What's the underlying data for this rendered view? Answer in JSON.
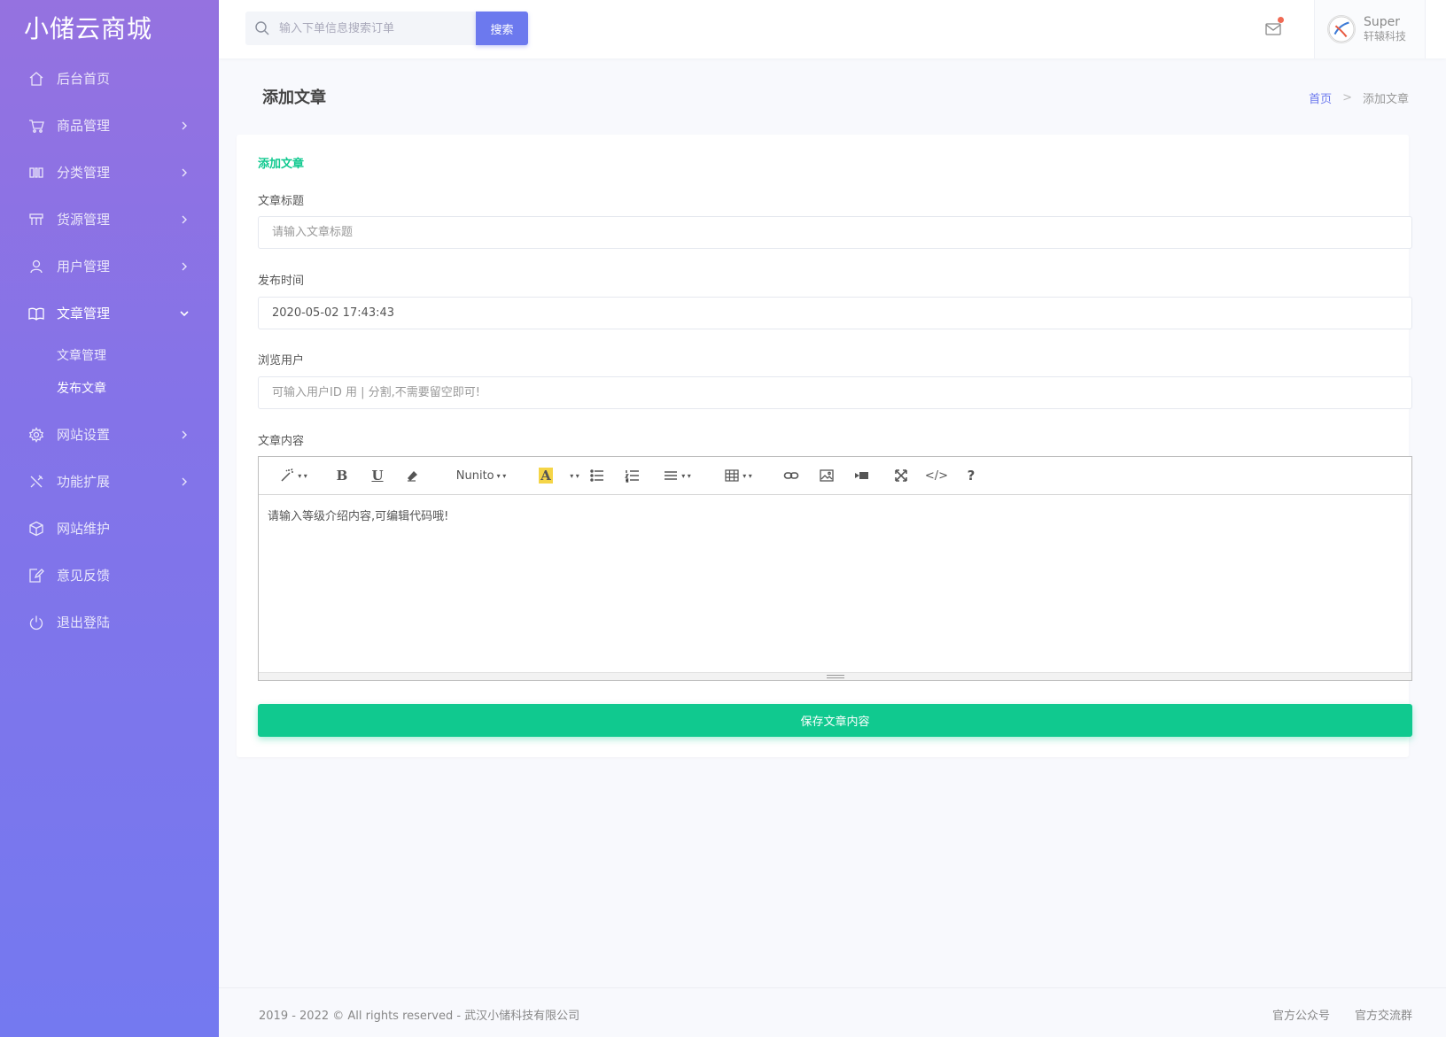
{
  "app": {
    "brand": "小储云商城"
  },
  "sidebar": {
    "items": [
      {
        "label": "后台首页"
      },
      {
        "label": "商品管理"
      },
      {
        "label": "分类管理"
      },
      {
        "label": "货源管理"
      },
      {
        "label": "用户管理"
      },
      {
        "label": "文章管理",
        "sub": [
          {
            "label": "文章管理"
          },
          {
            "label": "发布文章"
          }
        ]
      },
      {
        "label": "网站设置"
      },
      {
        "label": "功能扩展"
      },
      {
        "label": "网站维护"
      },
      {
        "label": "意见反馈"
      },
      {
        "label": "退出登陆"
      }
    ]
  },
  "topbar": {
    "search_placeholder": "输入下单信息搜索订单",
    "search_button": "搜索",
    "user_name": "Super",
    "user_company": "轩辕科技"
  },
  "page": {
    "title": "添加文章",
    "breadcrumb": {
      "home": "首页",
      "separator": ">",
      "current": "添加文章"
    }
  },
  "form": {
    "card_title": "添加文章",
    "title_label": "文章标题",
    "title_placeholder": "请输入文章标题",
    "time_label": "发布时间",
    "time_value": "2020-05-02 17:43:43",
    "users_label": "浏览用户",
    "users_placeholder": "可输入用户ID 用 | 分割,不需要留空即可!",
    "content_label": "文章内容",
    "editor_font": "Nunito",
    "editor_content": "请输入等级介绍内容,可编辑代码哦!",
    "save_button": "保存文章内容"
  },
  "footer": {
    "copyright": "2019 - 2022 © All rights reserved - 武汉小储科技有限公司",
    "links": [
      "官方公众号",
      "官方交流群"
    ]
  },
  "colors": {
    "accent": "#6c79ee",
    "success": "#10c98f",
    "sidebar_top": "#9572e0",
    "sidebar_bottom": "#7479f0"
  }
}
